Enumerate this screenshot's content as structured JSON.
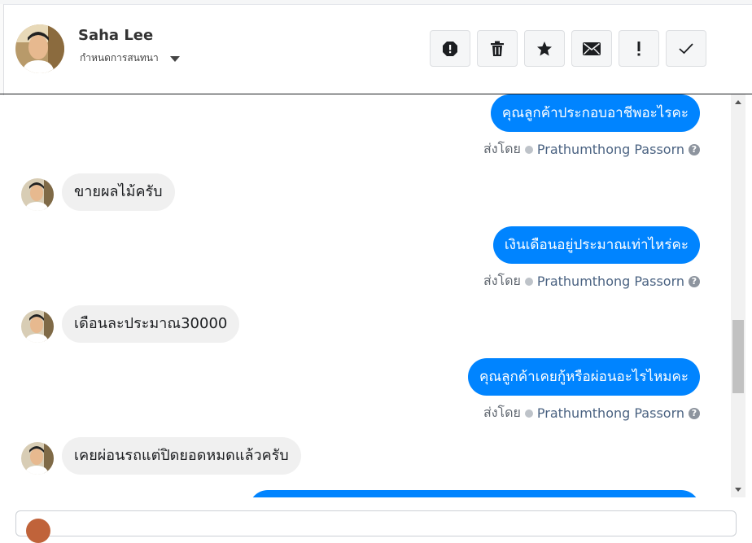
{
  "header": {
    "name": "Saha Lee",
    "assign_label": "กำหนดการสนทนา"
  },
  "toolbar": {
    "buttons": [
      {
        "icon": "alert-octagon-icon",
        "name": "spam-button"
      },
      {
        "icon": "trash-icon",
        "name": "delete-button"
      },
      {
        "icon": "star-icon",
        "name": "star-button"
      },
      {
        "icon": "envelope-icon",
        "name": "mark-unread-button"
      },
      {
        "icon": "exclamation-icon",
        "name": "follow-up-button"
      },
      {
        "icon": "checkmark-icon",
        "name": "mark-done-button"
      }
    ]
  },
  "messages": [
    {
      "type": "out",
      "text": "คุณลูกค้าประกอบอาชีพอะไรคะ",
      "sent_prefix": "ส่งโดย",
      "agent": "Prathumthong Passorn"
    },
    {
      "type": "in",
      "text": "ขายผลไม้ครับ"
    },
    {
      "type": "out",
      "text": "เงินเดือนอยู่ประมาณเท่าไหร่คะ",
      "sent_prefix": "ส่งโดย",
      "agent": "Prathumthong Passorn"
    },
    {
      "type": "in",
      "text": "เดือนละประมาณ30000"
    },
    {
      "type": "out",
      "text": "คุณลูกค้าเคยกู้หรือผ่อนอะไรไหมคะ",
      "sent_prefix": "ส่งโดย",
      "agent": "Prathumthong Passorn"
    },
    {
      "type": "in",
      "text": "เคยผ่อนรถแต่ปิดยอดหมดแล้วครับ"
    },
    {
      "type": "out",
      "text": ""
    }
  ],
  "colors": {
    "outgoing_bubble": "#0084ff",
    "incoming_bubble": "#f0f0f0",
    "agent_name": "#4b6382"
  }
}
